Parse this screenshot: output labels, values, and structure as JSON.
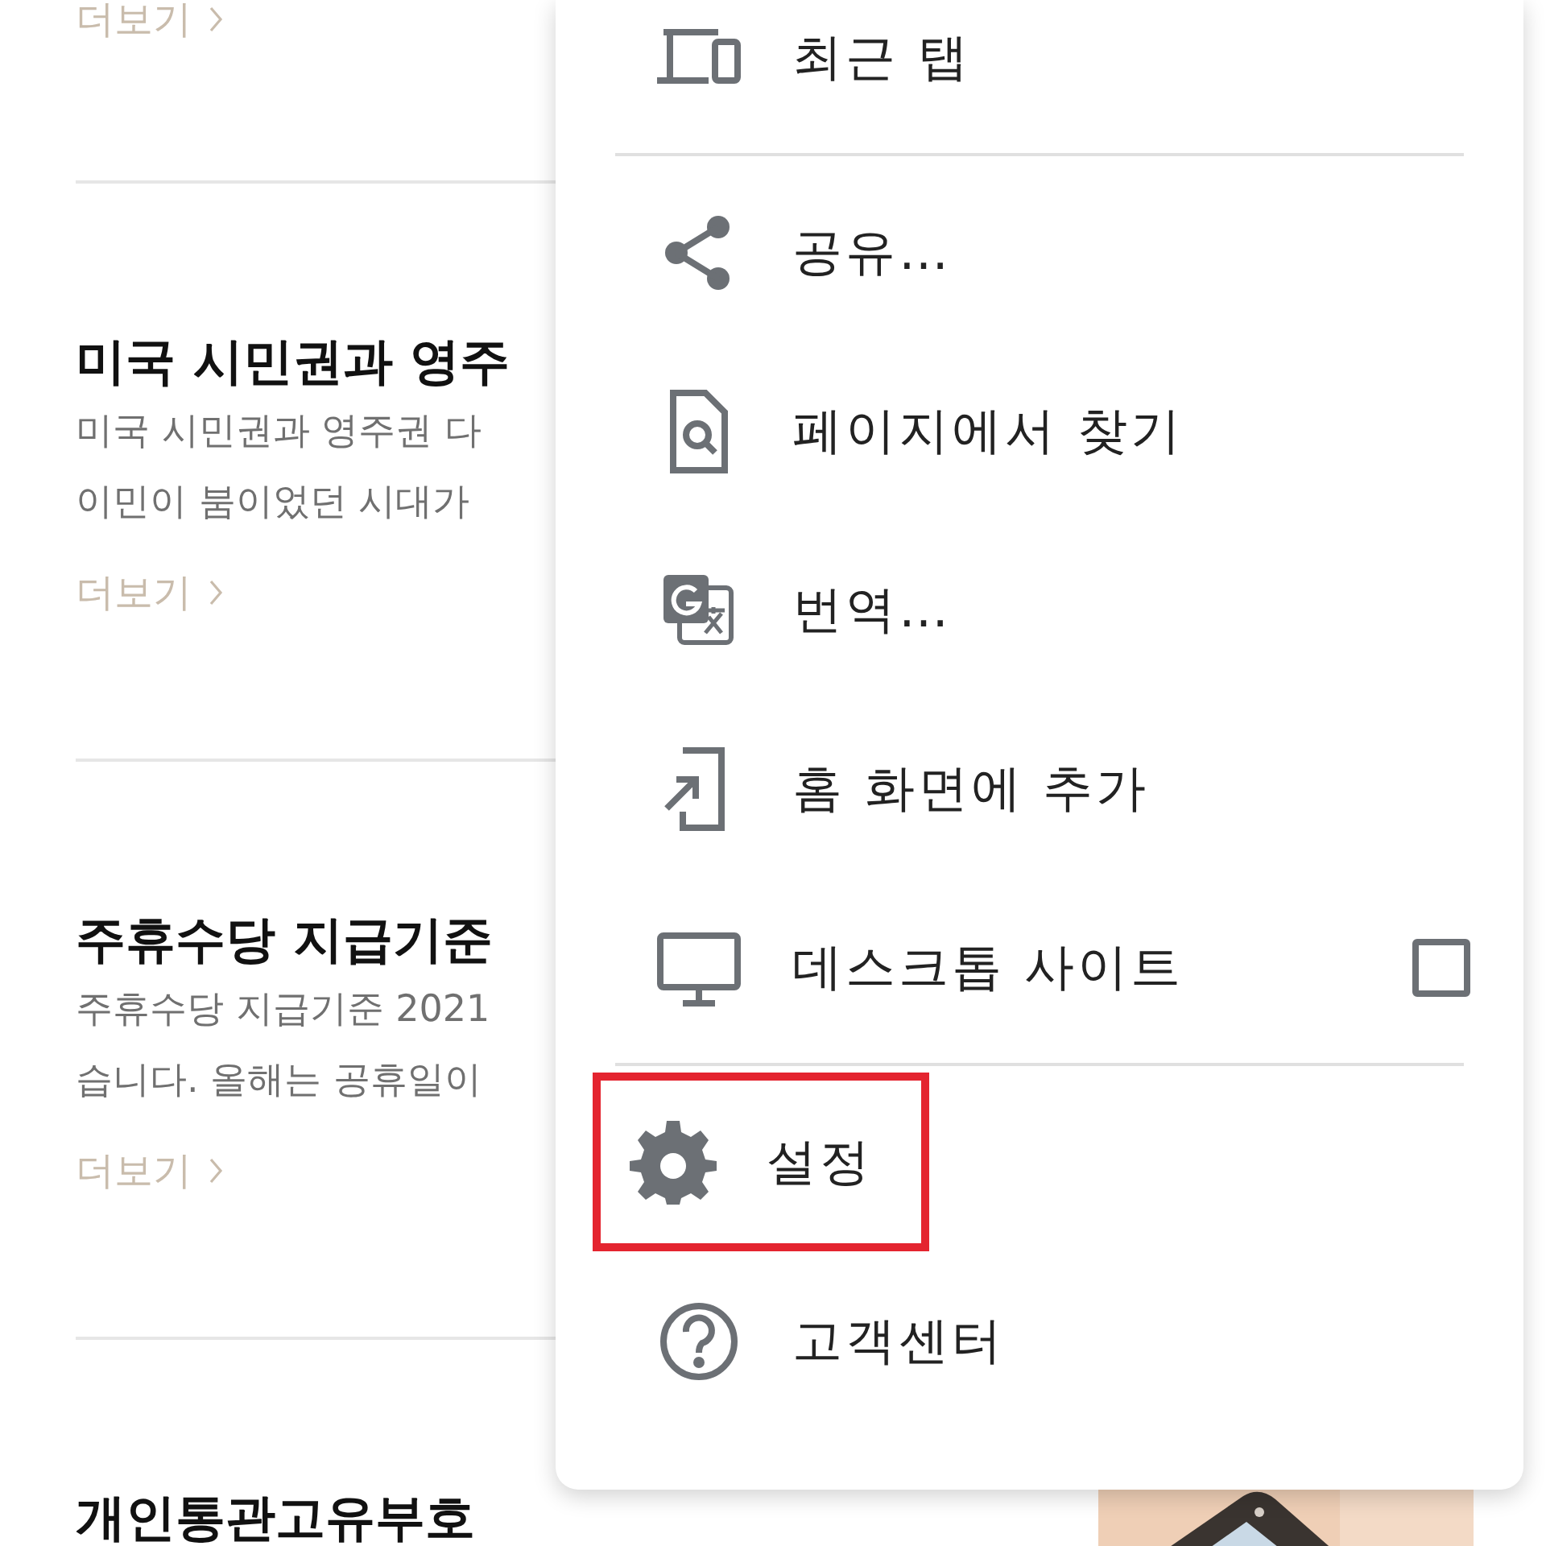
{
  "top_more_link": "더보기",
  "articles": [
    {
      "title": "미국 시민권과 영주",
      "lines": [
        "미국 시민권과 영주권 다",
        "이민이 붐이었던 시대가"
      ],
      "more": "더보기"
    },
    {
      "title": "주휴수당 지급기준",
      "lines": [
        "주휴수당 지급기준 2021",
        "습니다. 올해는 공휴일이"
      ],
      "more": "더보기"
    },
    {
      "title": "개인통관고유부호"
    }
  ],
  "menu": {
    "sections": [
      [
        {
          "label": "최근 탭",
          "highlighted": false
        }
      ],
      [
        {
          "label": "공유…",
          "highlighted": false
        },
        {
          "label": "페이지에서 찾기",
          "highlighted": false
        },
        {
          "label": "번역…",
          "highlighted": false
        },
        {
          "label": "홈 화면에 추가",
          "highlighted": false
        },
        {
          "label": "데스크톱 사이트",
          "highlighted": false,
          "checked": false
        }
      ],
      [
        {
          "label": "설정",
          "highlighted": true
        },
        {
          "label": "고객센터",
          "highlighted": false
        }
      ]
    ]
  }
}
